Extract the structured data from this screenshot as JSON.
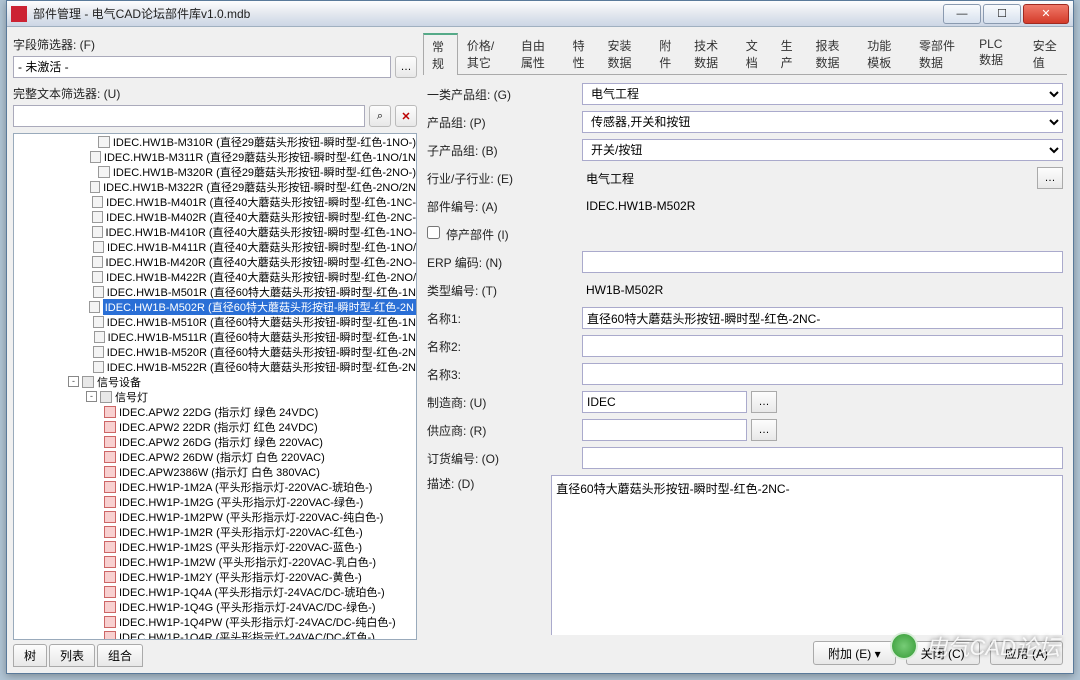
{
  "titlebar": {
    "title": "部件管理 - 电气CAD论坛部件库v1.0.mdb"
  },
  "left": {
    "field_filter_label": "字段筛选器: (F)",
    "field_filter_value": "- 未激活 -",
    "full_text_filter_label": "完整文本筛选器: (U)",
    "full_text_filter_value": "",
    "clear_btn": "×",
    "search_btn": "🜁",
    "bottom_tabs": [
      "树",
      "列表",
      "组合"
    ]
  },
  "tree": [
    {
      "d": 5,
      "i": "part",
      "t": "IDEC.HW1B-M310R (直径29蘑菇头形按钮-瞬时型-红色-1NO-)"
    },
    {
      "d": 5,
      "i": "part",
      "t": "IDEC.HW1B-M311R (直径29蘑菇头形按钮-瞬时型-红色-1NO/1N"
    },
    {
      "d": 5,
      "i": "part",
      "t": "IDEC.HW1B-M320R (直径29蘑菇头形按钮-瞬时型-红色-2NO-)"
    },
    {
      "d": 5,
      "i": "part",
      "t": "IDEC.HW1B-M322R (直径29蘑菇头形按钮-瞬时型-红色-2NO/2N"
    },
    {
      "d": 5,
      "i": "part",
      "t": "IDEC.HW1B-M401R (直径40大蘑菇头形按钮-瞬时型-红色-1NC-"
    },
    {
      "d": 5,
      "i": "part",
      "t": "IDEC.HW1B-M402R (直径40大蘑菇头形按钮-瞬时型-红色-2NC-"
    },
    {
      "d": 5,
      "i": "part",
      "t": "IDEC.HW1B-M410R (直径40大蘑菇头形按钮-瞬时型-红色-1NO-"
    },
    {
      "d": 5,
      "i": "part",
      "t": "IDEC.HW1B-M411R (直径40大蘑菇头形按钮-瞬时型-红色-1NO/"
    },
    {
      "d": 5,
      "i": "part",
      "t": "IDEC.HW1B-M420R (直径40大蘑菇头形按钮-瞬时型-红色-2NO-"
    },
    {
      "d": 5,
      "i": "part",
      "t": "IDEC.HW1B-M422R (直径40大蘑菇头形按钮-瞬时型-红色-2NO/"
    },
    {
      "d": 5,
      "i": "part",
      "t": "IDEC.HW1B-M501R (直径60特大蘑菇头形按钮-瞬时型-红色-1N"
    },
    {
      "d": 5,
      "i": "part",
      "t": "IDEC.HW1B-M502R (直径60特大蘑菇头形按钮-瞬时型-红色-2N",
      "sel": true
    },
    {
      "d": 5,
      "i": "part",
      "t": "IDEC.HW1B-M510R (直径60特大蘑菇头形按钮-瞬时型-红色-1N"
    },
    {
      "d": 5,
      "i": "part",
      "t": "IDEC.HW1B-M511R (直径60特大蘑菇头形按钮-瞬时型-红色-1N"
    },
    {
      "d": 5,
      "i": "part",
      "t": "IDEC.HW1B-M520R (直径60特大蘑菇头形按钮-瞬时型-红色-2N"
    },
    {
      "d": 5,
      "i": "part",
      "t": "IDEC.HW1B-M522R (直径60特大蘑菇头形按钮-瞬时型-红色-2N"
    },
    {
      "d": 3,
      "i": "folder",
      "tg": "-",
      "t": "信号设备"
    },
    {
      "d": 4,
      "i": "folder",
      "tg": "-",
      "t": "信号灯"
    },
    {
      "d": 5,
      "i": "lamp",
      "t": "IDEC.APW2 22DG (指示灯 绿色 24VDC)"
    },
    {
      "d": 5,
      "i": "lamp",
      "t": "IDEC.APW2 22DR (指示灯 红色 24VDC)"
    },
    {
      "d": 5,
      "i": "lamp",
      "t": "IDEC.APW2 26DG (指示灯 绿色 220VAC)"
    },
    {
      "d": 5,
      "i": "lamp",
      "t": "IDEC.APW2 26DW (指示灯 白色 220VAC)"
    },
    {
      "d": 5,
      "i": "lamp",
      "t": "IDEC.APW2386W (指示灯 白色 380VAC)"
    },
    {
      "d": 5,
      "i": "lamp",
      "t": "IDEC.HW1P-1M2A (平头形指示灯-220VAC-琥珀色-)"
    },
    {
      "d": 5,
      "i": "lamp",
      "t": "IDEC.HW1P-1M2G (平头形指示灯-220VAC-绿色-)"
    },
    {
      "d": 5,
      "i": "lamp",
      "t": "IDEC.HW1P-1M2PW (平头形指示灯-220VAC-纯白色-)"
    },
    {
      "d": 5,
      "i": "lamp",
      "t": "IDEC.HW1P-1M2R (平头形指示灯-220VAC-红色-)"
    },
    {
      "d": 5,
      "i": "lamp",
      "t": "IDEC.HW1P-1M2S (平头形指示灯-220VAC-蓝色-)"
    },
    {
      "d": 5,
      "i": "lamp",
      "t": "IDEC.HW1P-1M2W (平头形指示灯-220VAC-乳白色-)"
    },
    {
      "d": 5,
      "i": "lamp",
      "t": "IDEC.HW1P-1M2Y (平头形指示灯-220VAC-黄色-)"
    },
    {
      "d": 5,
      "i": "lamp",
      "t": "IDEC.HW1P-1Q4A (平头形指示灯-24VAC/DC-琥珀色-)"
    },
    {
      "d": 5,
      "i": "lamp",
      "t": "IDEC.HW1P-1Q4G (平头形指示灯-24VAC/DC-绿色-)"
    },
    {
      "d": 5,
      "i": "lamp",
      "t": "IDEC.HW1P-1Q4PW (平头形指示灯-24VAC/DC-纯白色-)"
    },
    {
      "d": 5,
      "i": "lamp",
      "t": "IDEC.HW1P-1Q4R (平头形指示灯-24VAC/DC-红色-)"
    }
  ],
  "tabs_top": [
    "常规",
    "价格/其它",
    "自由属性",
    "特性",
    "安装数据",
    "附件",
    "技术数据",
    "文档",
    "生产",
    "报表数据",
    "功能模板",
    "零部件数据",
    "PLC 数据",
    "安全值"
  ],
  "tabs_top_active": 0,
  "form": {
    "group1_label": "一类产品组: (G)",
    "group1_value": "电气工程",
    "group2_label": "产品组: (P)",
    "group2_value": "传感器,开关和按钮",
    "group3_label": "子产品组: (B)",
    "group3_value": "开关/按钮",
    "industry_label": "行业/子行业: (E)",
    "industry_value": "电气工程",
    "partno_label": "部件编号: (A)",
    "partno_value": "IDEC.HW1B-M502R",
    "discontinued_label": "停产部件 (I)",
    "erp_label": "ERP 编码: (N)",
    "erp_value": "",
    "type_label": "类型编号: (T)",
    "type_value": "HW1B-M502R",
    "name1_label": "名称1:",
    "name1_value": "直径60特大蘑菇头形按钮-瞬时型-红色-2NC-",
    "name2_label": "名称2:",
    "name2_value": "",
    "name3_label": "名称3:",
    "name3_value": "",
    "mfr_label": "制造商: (U)",
    "mfr_value": "IDEC",
    "supplier_label": "供应商: (R)",
    "supplier_value": "",
    "order_label": "订货编号: (O)",
    "order_value": "",
    "desc_label": "描述: (D)",
    "desc_value": "直径60特大蘑菇头形按钮-瞬时型-红色-2NC-"
  },
  "footer": {
    "extras": "附加 (E)",
    "close": "关闭 (C)",
    "apply": "应用 (A)"
  },
  "watermark": "电气CAD论坛"
}
